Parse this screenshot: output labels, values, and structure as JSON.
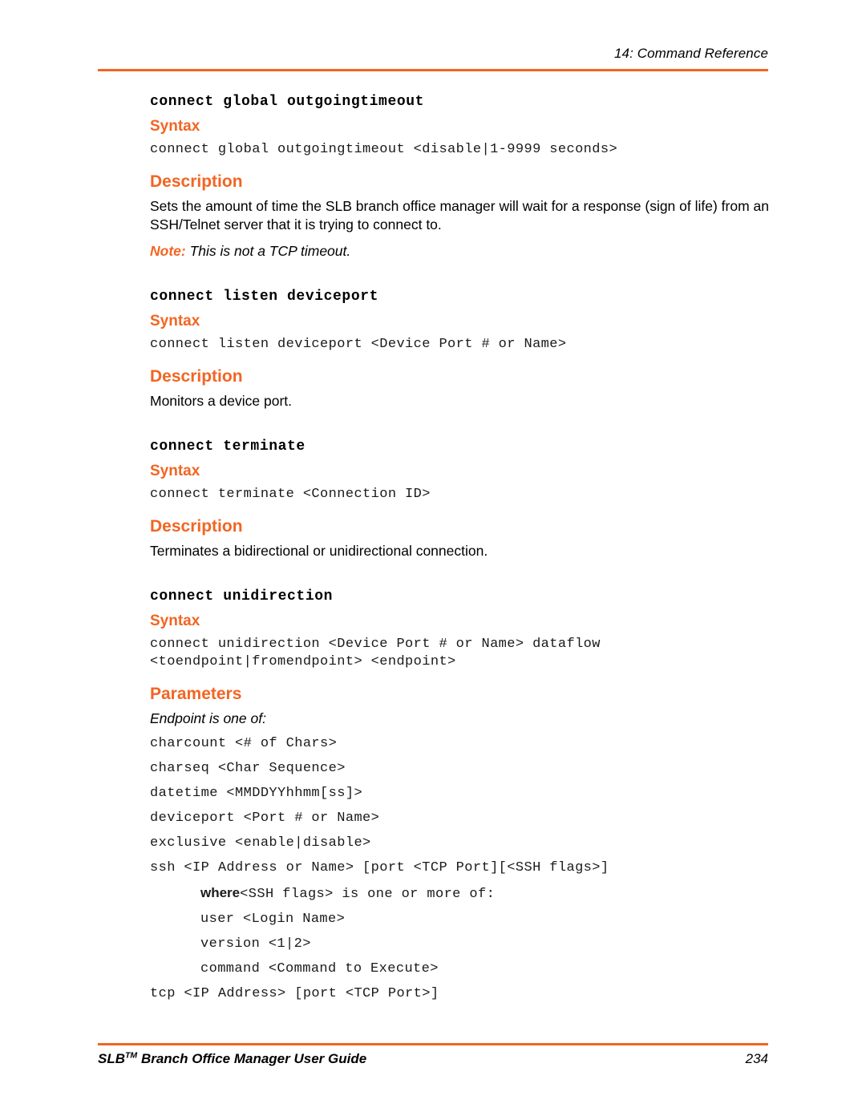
{
  "header": {
    "chapter_label": "14: Command Reference"
  },
  "footer": {
    "guide_title_prefix": "SLB",
    "guide_title_tm": "TM",
    "guide_title_rest": " Branch Office Manager User Guide",
    "page_number": "234"
  },
  "colors": {
    "accent_orange": "#F26522",
    "text_black": "#000000"
  },
  "headings": {
    "syntax": "Syntax",
    "description": "Description",
    "parameters": "Parameters"
  },
  "sections": [
    {
      "command": "connect global outgoingtimeout",
      "syntax_lines": [
        "connect global outgoingtimeout <disable|1-9999 seconds>"
      ],
      "description_paragraphs": [
        "Sets the amount of time the SLB branch office manager will wait for a response (sign of life) from an SSH/Telnet server that it is trying to connect to."
      ],
      "note": {
        "label": "Note:",
        "text": " This is not a TCP timeout."
      }
    },
    {
      "command": "connect listen deviceport",
      "syntax_lines": [
        "connect listen deviceport <Device Port # or Name>"
      ],
      "description_paragraphs": [
        "Monitors a device port."
      ]
    },
    {
      "command": "connect terminate",
      "syntax_lines": [
        "connect terminate <Connection ID>"
      ],
      "description_paragraphs": [
        "Terminates a bidirectional or unidirectional connection."
      ]
    },
    {
      "command": "connect unidirection",
      "syntax_lines": [
        "connect unidirection <Device Port # or Name> dataflow",
        "<toendpoint|fromendpoint> <endpoint>"
      ],
      "parameters": {
        "intro": "Endpoint is one of:",
        "items": [
          "charcount <# of Chars>",
          "charseq <Char Sequence>",
          "datetime <MMDDYYhhmm[ss]>",
          "deviceport <Port # or Name>",
          "exclusive <enable|disable>",
          "ssh <IP Address or Name> [port <TCP Port][<SSH flags>]"
        ],
        "ssh_flags": {
          "where_word": "where",
          "where_rest": "<SSH flags> is one or more of:",
          "items": [
            "user <Login Name>",
            "version <1|2>",
            "command <Command to Execute>"
          ]
        },
        "trailing_items": [
          "tcp <IP Address> [port <TCP Port>]"
        ]
      }
    }
  ]
}
